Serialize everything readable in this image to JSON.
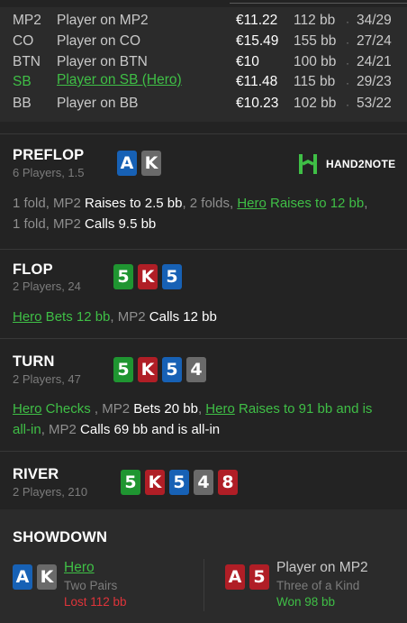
{
  "players": [
    {
      "position": "MP2",
      "name": "Player on MP2",
      "stack": "€11.22",
      "bb": "112 bb",
      "separator": "·",
      "cards": "34/29",
      "hero": false
    },
    {
      "position": "CO",
      "name": "Player on CO",
      "stack": "€15.49",
      "bb": "155 bb",
      "separator": "·",
      "cards": "27/24",
      "hero": false
    },
    {
      "position": "BTN",
      "name": "Player on BTN",
      "stack": "€10",
      "bb": "100 bb",
      "separator": "·",
      "cards": "24/21",
      "hero": false
    },
    {
      "position": "SB",
      "name": "Player on SB (Hero)",
      "stack": "€11.48",
      "bb": "115 bb",
      "separator": "·",
      "cards": "29/23",
      "hero": true
    },
    {
      "position": "BB",
      "name": "Player on BB",
      "stack": "€10.23",
      "bb": "102 bb",
      "separator": "·",
      "cards": "53/22",
      "hero": false
    }
  ],
  "logo": {
    "text": "HAND2NOTE",
    "icon": "h2n-logo-icon"
  },
  "preflop": {
    "title": "PREFLOP",
    "subtitle": "6 Players, 1.5",
    "cards": [
      {
        "rank": "A",
        "suit": "d"
      },
      {
        "rank": "K",
        "suit": "s"
      }
    ],
    "line1": [
      "1 fold, MP2 ",
      "Raises to 2.5 bb",
      ", 2 folds, ",
      "Hero",
      " Raises to 12 bb",
      ","
    ],
    "line2": [
      "1 fold, MP2 ",
      "Calls 9.5 bb"
    ]
  },
  "flop": {
    "title": "FLOP",
    "subtitle": "2 Players, 24",
    "cards": [
      {
        "rank": "5",
        "suit": "c"
      },
      {
        "rank": "K",
        "suit": "h"
      },
      {
        "rank": "5",
        "suit": "d"
      }
    ],
    "line1": [
      "Hero",
      " Bets 12 bb",
      ", MP2 ",
      "Calls 12 bb"
    ]
  },
  "turn": {
    "title": "TURN",
    "subtitle": "2 Players, 47",
    "cards": [
      {
        "rank": "5",
        "suit": "c"
      },
      {
        "rank": "K",
        "suit": "h"
      },
      {
        "rank": "5",
        "suit": "d"
      },
      {
        "rank": "4",
        "suit": "s"
      }
    ],
    "line1": [
      "Hero",
      " Checks ",
      ", MP2 ",
      "Bets 20 bb",
      ", ",
      "Hero",
      " Raises to 91 bb and is"
    ],
    "line2": [
      "all-in",
      ", MP2 ",
      "Calls 69 bb and is all-in"
    ]
  },
  "river": {
    "title": "RIVER",
    "subtitle": "2 Players, 210",
    "cards": [
      {
        "rank": "5",
        "suit": "c"
      },
      {
        "rank": "K",
        "suit": "h"
      },
      {
        "rank": "5",
        "suit": "d"
      },
      {
        "rank": "4",
        "suit": "s"
      },
      {
        "rank": "8",
        "suit": "h"
      }
    ]
  },
  "showdown": {
    "title": "SHOWDOWN",
    "hero": {
      "name": "Hero",
      "hand": "Two Pairs",
      "result": "Lost 112 bb",
      "cards": [
        {
          "rank": "A",
          "suit": "d"
        },
        {
          "rank": "K",
          "suit": "s"
        }
      ]
    },
    "villain": {
      "name": "Player on MP2",
      "hand": "Three of a Kind",
      "result": "Won 98 bb",
      "cards": [
        {
          "rank": "A",
          "suit": "h"
        },
        {
          "rank": "5",
          "suit": "h"
        }
      ]
    }
  },
  "colors": {
    "hero_green": "#3fbf46",
    "loss_red": "#e0343a",
    "club": "#1f9531",
    "heart": "#b01e26",
    "diamond": "#1761b5",
    "spade": "#6a6a6a"
  }
}
